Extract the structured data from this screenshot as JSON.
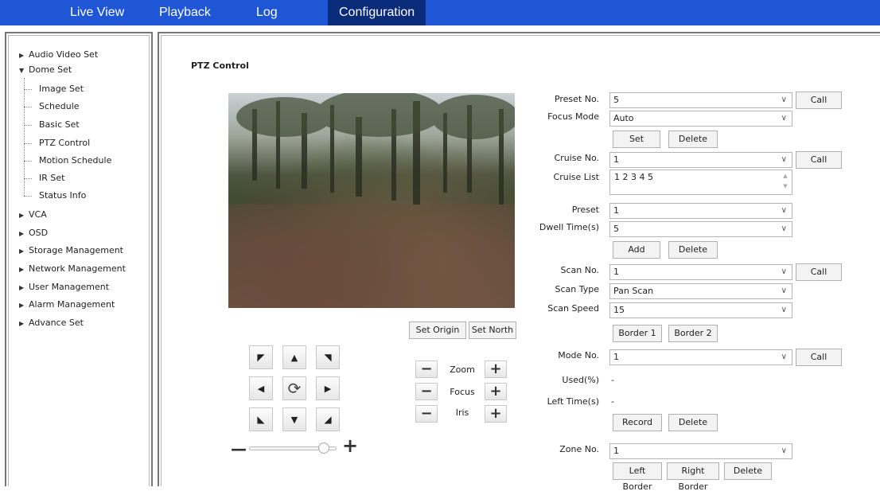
{
  "topnav": {
    "tabs": [
      "Live View",
      "Playback",
      "Log",
      "Configuration"
    ],
    "active": "Configuration"
  },
  "sidebar": {
    "items": [
      {
        "label": "Audio Video Set",
        "expanded": false
      },
      {
        "label": "Dome Set",
        "expanded": true,
        "children": [
          "Image Set",
          "Schedule",
          "Basic Set",
          "PTZ Control",
          "Motion Schedule",
          "IR Set",
          "Status Info"
        ]
      },
      {
        "label": "VCA",
        "expanded": false
      },
      {
        "label": "OSD",
        "expanded": false
      },
      {
        "label": "Storage Management",
        "expanded": false
      },
      {
        "label": "Network Management",
        "expanded": false
      },
      {
        "label": "User Management",
        "expanded": false
      },
      {
        "label": "Alarm Management",
        "expanded": false
      },
      {
        "label": "Advance Set",
        "expanded": false
      }
    ],
    "selected": "PTZ Control"
  },
  "page": {
    "title": "PTZ Control"
  },
  "video": {
    "set_origin": "Set Origin",
    "set_north": "Set North"
  },
  "ptz": {
    "zoom": "Zoom",
    "focus": "Focus",
    "iris": "Iris",
    "minus": "−",
    "plus": "+",
    "speed_level": 0.85
  },
  "form": {
    "preset_no": {
      "label": "Preset No.",
      "value": "5",
      "call": "Call"
    },
    "focus_mode": {
      "label": "Focus Mode",
      "value": "Auto"
    },
    "preset_set": "Set",
    "preset_delete": "Delete",
    "cruise_no": {
      "label": "Cruise No.",
      "value": "1",
      "call": "Call"
    },
    "cruise_list": {
      "label": "Cruise List",
      "value": "1 2 3 4 5"
    },
    "preset": {
      "label": "Preset",
      "value": "1"
    },
    "dwell_time": {
      "label": "Dwell Time(s)",
      "value": "5"
    },
    "cruise_add": "Add",
    "cruise_delete": "Delete",
    "scan_no": {
      "label": "Scan No.",
      "value": "1",
      "call": "Call"
    },
    "scan_type": {
      "label": "Scan Type",
      "value": "Pan Scan"
    },
    "scan_speed": {
      "label": "Scan Speed",
      "value": "15"
    },
    "border1": "Border 1",
    "border2": "Border 2",
    "mode_no": {
      "label": "Mode No.",
      "value": "1",
      "call": "Call"
    },
    "used": {
      "label": "Used(%)",
      "value": "-"
    },
    "left_time": {
      "label": "Left Time(s)",
      "value": "-"
    },
    "record": "Record",
    "mode_delete": "Delete",
    "zone_no": {
      "label": "Zone No.",
      "value": "1"
    },
    "left_border": "Left Border",
    "right_border": "Right Border",
    "zone_delete": "Delete"
  }
}
